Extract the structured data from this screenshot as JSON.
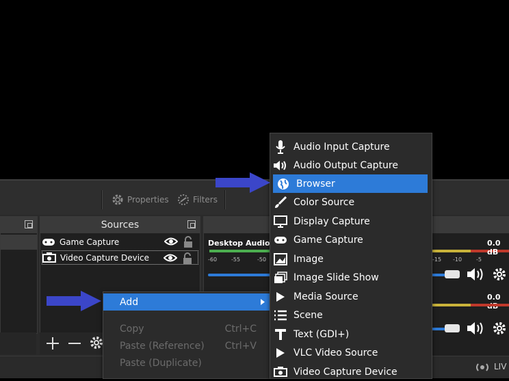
{
  "toolbar": {
    "properties_label": "Properties",
    "filters_label": "Filters"
  },
  "sources": {
    "title": "Sources",
    "items": [
      {
        "label": "Game Capture",
        "icon": "gamepad-icon"
      },
      {
        "label": "Video Capture Device",
        "icon": "camera-icon"
      }
    ]
  },
  "mixer": {
    "desktop_audio_label": "Desktop Audio",
    "ticks_left": [
      "-60",
      "-55",
      "-50"
    ],
    "ticks_right": [
      "-15",
      "-10",
      "-5"
    ],
    "levels": [
      "0.0 dB",
      "0.0 dB"
    ]
  },
  "context_menu": {
    "add_label": "Add",
    "copy_label": "Copy",
    "copy_shortcut": "Ctrl+C",
    "paste_ref_label": "Paste (Reference)",
    "paste_ref_shortcut": "Ctrl+V",
    "paste_dup_label": "Paste (Duplicate)"
  },
  "add_submenu": {
    "items": [
      {
        "label": "Audio Input Capture",
        "icon": "microphone-icon"
      },
      {
        "label": "Audio Output Capture",
        "icon": "speaker-icon"
      },
      {
        "label": "Browser",
        "icon": "globe-icon",
        "highlighted": true
      },
      {
        "label": "Color Source",
        "icon": "paintbrush-icon"
      },
      {
        "label": "Display Capture",
        "icon": "monitor-icon"
      },
      {
        "label": "Game Capture",
        "icon": "gamepad-icon"
      },
      {
        "label": "Image",
        "icon": "image-icon"
      },
      {
        "label": "Image Slide Show",
        "icon": "slideshow-icon"
      },
      {
        "label": "Media Source",
        "icon": "play-icon"
      },
      {
        "label": "Scene",
        "icon": "list-icon"
      },
      {
        "label": "Text (GDI+)",
        "icon": "text-icon"
      },
      {
        "label": "VLC Video Source",
        "icon": "play-icon"
      },
      {
        "label": "Video Capture Device",
        "icon": "camera-icon"
      }
    ]
  },
  "status": {
    "live_label": "LIV"
  },
  "colors": {
    "highlight": "#2d7bd8",
    "arrow": "#3b46c9",
    "meter_green": "#4caf50"
  }
}
